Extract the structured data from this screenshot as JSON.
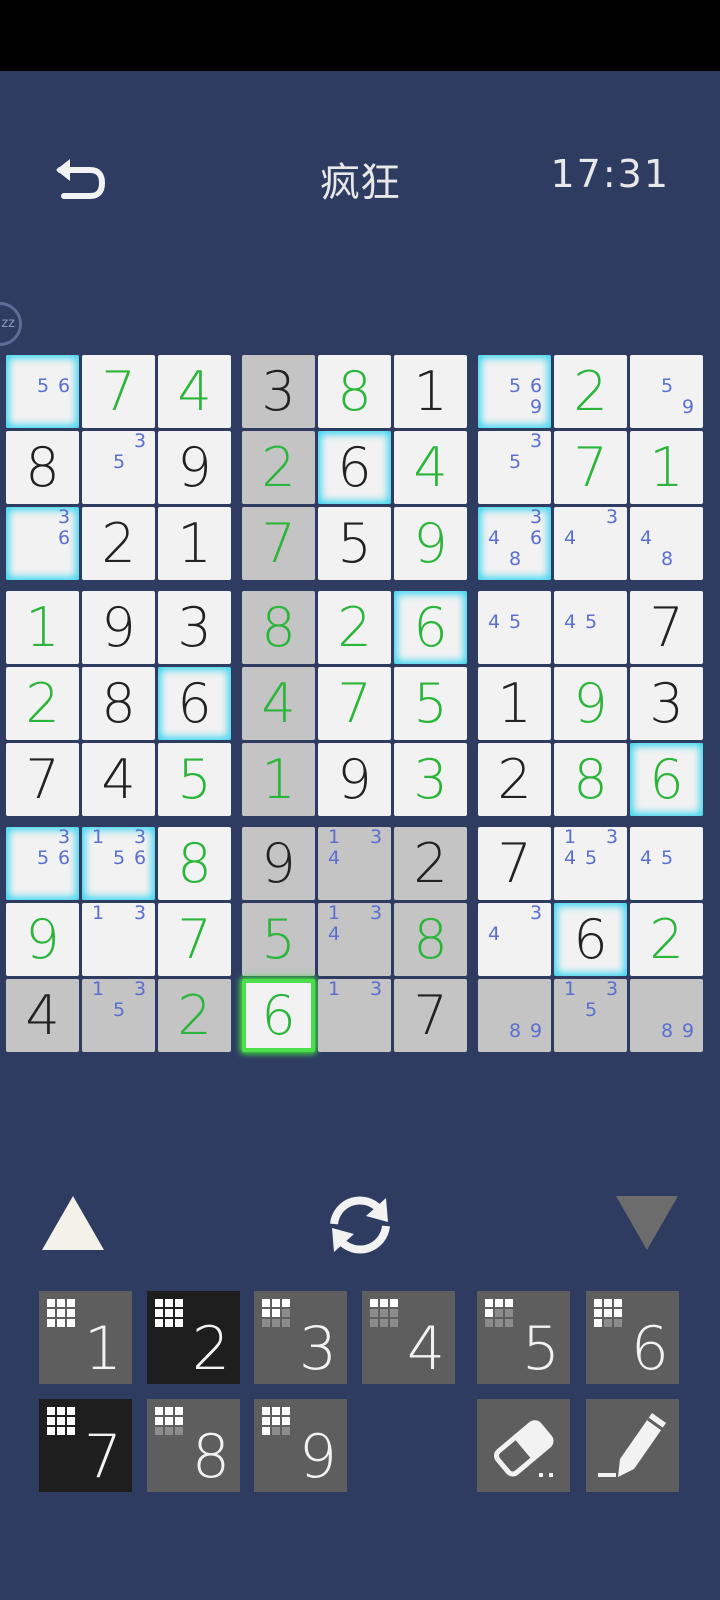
{
  "header": {
    "title": "疯狂",
    "timer": "17:31"
  },
  "badge": {
    "text": "zz"
  },
  "board": {
    "rows": [
      [
        {
          "v": "",
          "n": [
            5,
            6
          ],
          "g": 1
        },
        {
          "v": "7",
          "k": "e"
        },
        {
          "v": "4",
          "k": "e"
        },
        {
          "v": "3",
          "k": "g",
          "s": 1
        },
        {
          "v": "8",
          "k": "e"
        },
        {
          "v": "1",
          "k": "g"
        },
        {
          "v": "",
          "n": [
            5,
            6,
            9
          ],
          "g": 1
        },
        {
          "v": "2",
          "k": "e"
        },
        {
          "v": "",
          "n": [
            5,
            9
          ]
        }
      ],
      [
        {
          "v": "8",
          "k": "g"
        },
        {
          "v": "",
          "n": [
            3,
            5
          ]
        },
        {
          "v": "9",
          "k": "g"
        },
        {
          "v": "2",
          "k": "e",
          "s": 1
        },
        {
          "v": "6",
          "k": "g",
          "g": 1
        },
        {
          "v": "4",
          "k": "e"
        },
        {
          "v": "",
          "n": [
            3,
            5
          ]
        },
        {
          "v": "7",
          "k": "e"
        },
        {
          "v": "1",
          "k": "e"
        }
      ],
      [
        {
          "v": "",
          "n": [
            3,
            6
          ],
          "g": 1
        },
        {
          "v": "2",
          "k": "g"
        },
        {
          "v": "1",
          "k": "g"
        },
        {
          "v": "7",
          "k": "e",
          "s": 1
        },
        {
          "v": "5",
          "k": "g"
        },
        {
          "v": "9",
          "k": "e"
        },
        {
          "v": "",
          "n": [
            3,
            4,
            6,
            8
          ],
          "g": 1
        },
        {
          "v": "",
          "n": [
            3,
            4
          ]
        },
        {
          "v": "",
          "n": [
            4,
            8
          ]
        }
      ],
      [
        {
          "v": "1",
          "k": "e"
        },
        {
          "v": "9",
          "k": "g"
        },
        {
          "v": "3",
          "k": "g"
        },
        {
          "v": "8",
          "k": "e",
          "s": 1
        },
        {
          "v": "2",
          "k": "e"
        },
        {
          "v": "6",
          "k": "e",
          "g": 1
        },
        {
          "v": "",
          "n": [
            4,
            5
          ]
        },
        {
          "v": "",
          "n": [
            4,
            5
          ]
        },
        {
          "v": "7",
          "k": "g"
        }
      ],
      [
        {
          "v": "2",
          "k": "e"
        },
        {
          "v": "8",
          "k": "g"
        },
        {
          "v": "6",
          "k": "g",
          "g": 1
        },
        {
          "v": "4",
          "k": "e",
          "s": 1
        },
        {
          "v": "7",
          "k": "e"
        },
        {
          "v": "5",
          "k": "e"
        },
        {
          "v": "1",
          "k": "g"
        },
        {
          "v": "9",
          "k": "e"
        },
        {
          "v": "3",
          "k": "g"
        }
      ],
      [
        {
          "v": "7",
          "k": "g"
        },
        {
          "v": "4",
          "k": "g"
        },
        {
          "v": "5",
          "k": "e"
        },
        {
          "v": "1",
          "k": "e",
          "s": 1
        },
        {
          "v": "9",
          "k": "g"
        },
        {
          "v": "3",
          "k": "e"
        },
        {
          "v": "2",
          "k": "g"
        },
        {
          "v": "8",
          "k": "e"
        },
        {
          "v": "6",
          "k": "e",
          "g": 1
        }
      ],
      [
        {
          "v": "",
          "n": [
            3,
            5,
            6
          ],
          "g": 1
        },
        {
          "v": "",
          "n": [
            1,
            3,
            5,
            6
          ],
          "g": 1
        },
        {
          "v": "8",
          "k": "e"
        },
        {
          "v": "9",
          "k": "g",
          "s": 1
        },
        {
          "v": "",
          "n": [
            1,
            3,
            4
          ],
          "s": 1
        },
        {
          "v": "2",
          "k": "g",
          "s": 1
        },
        {
          "v": "7",
          "k": "g"
        },
        {
          "v": "",
          "n": [
            1,
            3,
            4,
            5
          ]
        },
        {
          "v": "",
          "n": [
            4,
            5
          ]
        }
      ],
      [
        {
          "v": "9",
          "k": "e"
        },
        {
          "v": "",
          "n": [
            1,
            3
          ]
        },
        {
          "v": "7",
          "k": "e"
        },
        {
          "v": "5",
          "k": "e",
          "s": 1
        },
        {
          "v": "",
          "n": [
            1,
            3,
            4
          ],
          "s": 1
        },
        {
          "v": "8",
          "k": "e",
          "s": 1
        },
        {
          "v": "",
          "n": [
            3,
            4
          ]
        },
        {
          "v": "6",
          "k": "g",
          "g": 1
        },
        {
          "v": "2",
          "k": "e"
        }
      ],
      [
        {
          "v": "4",
          "k": "g",
          "s": 1
        },
        {
          "v": "",
          "n": [
            1,
            3,
            5
          ],
          "s": 1
        },
        {
          "v": "2",
          "k": "e",
          "s": 1
        },
        {
          "v": "6",
          "k": "e",
          "sel": 1
        },
        {
          "v": "",
          "n": [
            1,
            3
          ],
          "s": 1
        },
        {
          "v": "7",
          "k": "g",
          "s": 1
        },
        {
          "v": "",
          "n": [
            8,
            9
          ],
          "s": 1
        },
        {
          "v": "",
          "n": [
            1,
            3,
            5
          ],
          "s": 1
        },
        {
          "v": "",
          "n": [
            8,
            9
          ],
          "s": 1
        }
      ]
    ]
  },
  "keypad": {
    "keys": [
      {
        "label": "1",
        "dark": false,
        "count": 9
      },
      {
        "label": "2",
        "dark": true,
        "count": 9
      },
      {
        "label": "3",
        "dark": false,
        "count": 5
      },
      {
        "label": "4",
        "dark": false,
        "count": 3
      },
      {
        "label": "5",
        "dark": false,
        "count": 4
      },
      {
        "label": "6",
        "dark": false,
        "count": 7
      },
      {
        "label": "7",
        "dark": true,
        "count": 9
      },
      {
        "label": "8",
        "dark": false,
        "count": 6
      },
      {
        "label": "9",
        "dark": false,
        "count": 7
      }
    ]
  },
  "colors": {
    "background": "#2f3c62",
    "entered": "#2cb53b",
    "given": "#222222",
    "note": "#5a6fd0",
    "highlight": "#39d4f0",
    "selected": "#4be04b"
  }
}
